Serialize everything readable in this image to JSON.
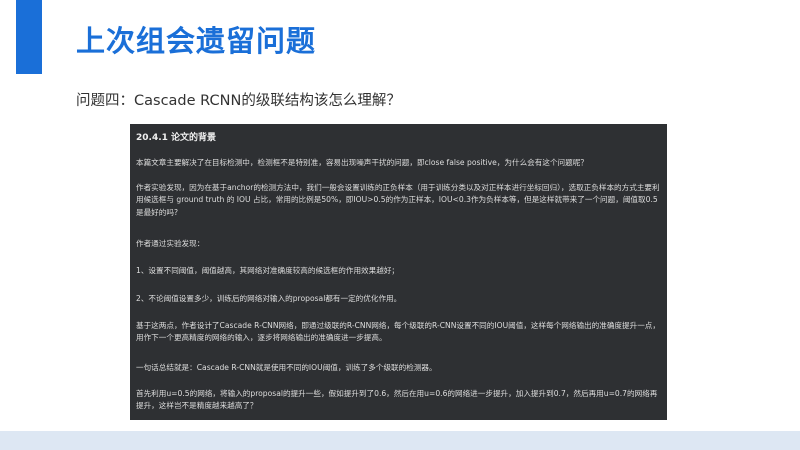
{
  "slide": {
    "title": "上次组会遗留问题",
    "question": "问题四：Cascade RCNN的级联结构该怎么理解？"
  },
  "excerpt": {
    "header": "20.4.1 论文的背景",
    "paragraphs": [
      "本篇文章主要解决了在目标检测中，检测框不是特别准，容易出现噪声干扰的问题，即close false positive，为什么会有这个问题呢？",
      "作者实验发现，因为在基于anchor的检测方法中，我们一般会设置训练的正负样本（用于训练分类以及对正样本进行坐标回归），选取正负样本的方式主要利用候选框与 ground truth 的 IOU 占比，常用的比例是50%，即IOU>0.5的作为正样本，IOU<0.3作为负样本等，但是这样就带来了一个问题，阈值取0.5是最好的吗?",
      "作者通过实验发现：",
      "1、设置不同阈值，阈值越高，其网络对准确度较高的候选框的作用效果越好；",
      "2、不论阈值设置多少，训练后的网络对输入的proposal都有一定的优化作用。",
      "基于这两点，作者设计了Cascade R-CNN网络，即通过级联的R-CNN网络，每个级联的R-CNN设置不同的IOU阈值，这样每个网络输出的准确度提升一点，用作下一个更高精度的网络的输入，逐步将网络输出的准确度进一步提高。",
      "一句话总结就是：Cascade R-CNN就是使用不同的IOU阈值，训练了多个级联的检测器。",
      "首先利用u=0.5的网络，将输入的proposal的提升一些，假如提升到了0.6，然后在用u=0.6的网络进一步提升，加入提升到0.7，然后再用u=0.7的网络再提升，这样岂不是精度越来越高了？"
    ]
  },
  "colors": {
    "accent": "#1a6fd8",
    "excerpt_bg": "#2e3033",
    "bottom_band": "#dde7f3"
  }
}
